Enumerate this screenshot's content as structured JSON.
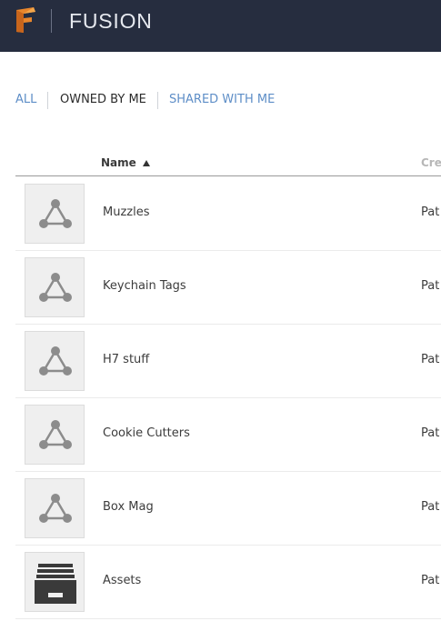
{
  "header": {
    "logo_icon": "fusion-f-logo-icon",
    "title": "FUSION",
    "background": "#262d3f"
  },
  "tabs": [
    {
      "label": "ALL",
      "active": false
    },
    {
      "label": "OWNED BY ME",
      "active": true
    },
    {
      "label": "SHARED WITH ME",
      "active": false
    }
  ],
  "table": {
    "columns": [
      {
        "label": "Name",
        "sort": "ascending"
      },
      {
        "label": "Crea"
      }
    ],
    "rows": [
      {
        "name": "Muzzles",
        "creator": "Pat",
        "icon": "project-triangle-icon"
      },
      {
        "name": "Keychain Tags",
        "creator": "Pat",
        "icon": "project-triangle-icon"
      },
      {
        "name": "H7 stuff",
        "creator": "Pat",
        "icon": "project-triangle-icon"
      },
      {
        "name": "Cookie Cutters",
        "creator": "Pat",
        "icon": "project-triangle-icon"
      },
      {
        "name": "Box Mag",
        "creator": "Pat",
        "icon": "project-triangle-icon"
      },
      {
        "name": "Assets",
        "creator": "Pat",
        "icon": "assets-drawer-icon"
      }
    ]
  },
  "colors": {
    "accent": "#5e8ec7",
    "icon_gray": "#8c8c8c",
    "logo_orange": "#e8862c"
  }
}
